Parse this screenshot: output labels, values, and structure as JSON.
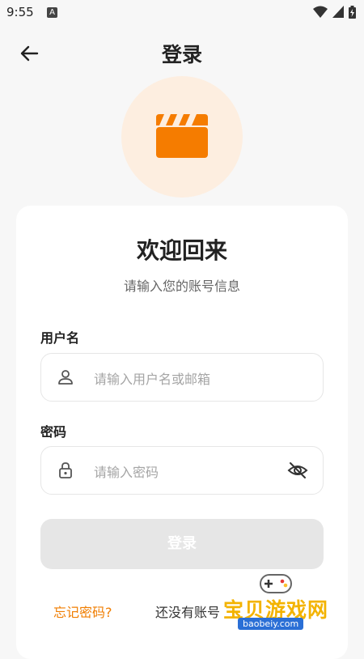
{
  "status_bar": {
    "time": "9:55",
    "notification_icon": "a-icon"
  },
  "header": {
    "title": "登录",
    "back_icon": "arrow-left-icon"
  },
  "logo": {
    "icon": "clapperboard-icon",
    "accent_color": "#f57c00",
    "bg_color": "#fdeee0"
  },
  "card": {
    "welcome": "欢迎回来",
    "subtitle": "请输入您的账号信息",
    "username": {
      "label": "用户名",
      "placeholder": "请输入用户名或邮箱",
      "icon": "user-icon"
    },
    "password": {
      "label": "密码",
      "placeholder": "请输入密码",
      "icon": "lock-icon",
      "toggle_icon": "eye-off-icon"
    },
    "login_button": "登录",
    "forgot_link": "忘记密码?",
    "no_account_text": "还没有账号"
  },
  "watermark": {
    "text": "宝贝游戏网",
    "url": "baobeiy.com"
  }
}
